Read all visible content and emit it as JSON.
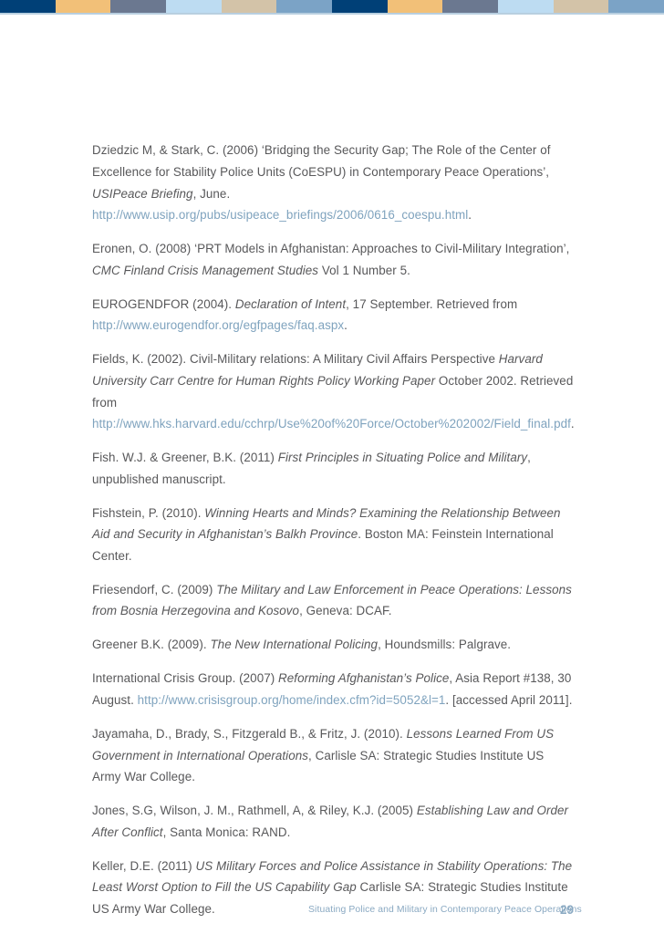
{
  "document": {
    "type": "academic-paper-bibliography",
    "page_number": "29",
    "footer_running_title": "Situating Police and Military in Contemporary Peace Operations"
  },
  "decor": {
    "top_bar_colors": [
      "#004077",
      "#f2c078",
      "#6b7890",
      "#bddcf2",
      "#d3c3a8",
      "#7ba3c6",
      "#004077",
      "#f2c078",
      "#6b7890",
      "#bddcf2",
      "#d3c3a8",
      "#7ba3c6"
    ],
    "rule_color": "#b8cfe0",
    "body_text_color": "#58585a",
    "link_color": "#7fa3be"
  },
  "references": [
    {
      "id": "dziedzic-stark-2006",
      "parts": [
        {
          "text": "Dziedzic M, & Stark, C. (2006) ‘Bridging the Security Gap; The Role of the Center of Excellence for Stability Police Units (CoESPU) in Contemporary Peace Operations’, ",
          "style": "normal"
        },
        {
          "text": "USIPeace Briefing",
          "style": "italic"
        },
        {
          "text": ", June. ",
          "style": "normal"
        },
        {
          "text": "http://www.usip.org/pubs/usipeace_briefings/2006/0616_coespu.html",
          "style": "url"
        },
        {
          "text": ".",
          "style": "normal"
        }
      ]
    },
    {
      "id": "eronen-2008",
      "parts": [
        {
          "text": "Eronen, O. (2008) ‘PRT Models in Afghanistan: Approaches to Civil-Military Integration’, ",
          "style": "normal"
        },
        {
          "text": "CMC Finland Crisis Management Studies",
          "style": "italic"
        },
        {
          "text": " Vol 1 Number 5.",
          "style": "normal"
        }
      ]
    },
    {
      "id": "eurogendfor-2004",
      "parts": [
        {
          "text": "EUROGENDFOR (2004). ",
          "style": "normal"
        },
        {
          "text": "Declaration of Intent",
          "style": "italic"
        },
        {
          "text": ", 17 September. Retrieved from ",
          "style": "normal"
        },
        {
          "text": "http://www.eurogendfor.org/egfpages/faq.aspx",
          "style": "url"
        },
        {
          "text": ".",
          "style": "normal"
        }
      ]
    },
    {
      "id": "fields-2002",
      "parts": [
        {
          "text": "Fields, K. (2002). Civil-Military relations: A Military Civil Affairs Perspective ",
          "style": "normal"
        },
        {
          "text": "Harvard University Carr Centre for Human Rights Policy Working Paper",
          "style": "italic"
        },
        {
          "text": " October 2002. Retrieved from ",
          "style": "normal"
        },
        {
          "text": "http://www.hks.harvard.edu/cchrp/Use%20of%20Force/October%202002/Field_final.pdf",
          "style": "url"
        },
        {
          "text": ".",
          "style": "normal"
        }
      ]
    },
    {
      "id": "fish-greener-2011",
      "parts": [
        {
          "text": "Fish. W.J. & Greener, B.K. (2011) ",
          "style": "normal"
        },
        {
          "text": "First Principles in Situating Police and Military",
          "style": "italic"
        },
        {
          "text": ", unpublished manuscript.",
          "style": "normal"
        }
      ]
    },
    {
      "id": "fishstein-2010",
      "parts": [
        {
          "text": "Fishstein, P. (2010). ",
          "style": "normal"
        },
        {
          "text": "Winning Hearts and Minds? Examining the Relationship Between Aid and Security in Afghanistan’s Balkh Province",
          "style": "italic"
        },
        {
          "text": ". Boston MA: Feinstein International Center.",
          "style": "normal"
        }
      ]
    },
    {
      "id": "friesendorf-2009",
      "parts": [
        {
          "text": "Friesendorf, C. (2009) ",
          "style": "normal"
        },
        {
          "text": "The Military and Law Enforcement in Peace Operations: Lessons from Bosnia Herzegovina and Kosovo",
          "style": "italic"
        },
        {
          "text": ", Geneva: DCAF.",
          "style": "normal"
        }
      ]
    },
    {
      "id": "greener-2009",
      "parts": [
        {
          "text": "Greener B.K. (2009). ",
          "style": "normal"
        },
        {
          "text": "The New International Policing",
          "style": "italic"
        },
        {
          "text": ", Houndsmills: Palgrave.",
          "style": "normal"
        }
      ]
    },
    {
      "id": "international-crisis-group-2007",
      "parts": [
        {
          "text": "International Crisis Group. (2007) ",
          "style": "normal"
        },
        {
          "text": "Reforming Afghanistan’s Police",
          "style": "italic"
        },
        {
          "text": ", Asia Report #138, 30 August. ",
          "style": "normal"
        },
        {
          "text": "http://www.crisisgroup.org/home/index.cfm?id=5052&l=1",
          "style": "url"
        },
        {
          "text": ". [accessed April 2011].",
          "style": "normal"
        }
      ]
    },
    {
      "id": "jayamaha-2010",
      "parts": [
        {
          "text": "Jayamaha, D., Brady, S., Fitzgerald B., & Fritz, J. (2010). ",
          "style": "normal"
        },
        {
          "text": "Lessons Learned From US Government in International Operations",
          "style": "italic"
        },
        {
          "text": ", Carlisle SA: Strategic Studies Institute US Army War College.",
          "style": "normal"
        }
      ]
    },
    {
      "id": "jones-2005",
      "parts": [
        {
          "text": "Jones, S.G, Wilson, J. M., Rathmell, A, & Riley, K.J. (2005) ",
          "style": "normal"
        },
        {
          "text": "Establishing Law and Order After Conflict",
          "style": "italic"
        },
        {
          "text": ", Santa Monica: RAND.",
          "style": "normal"
        }
      ]
    },
    {
      "id": "keller-2011",
      "parts": [
        {
          "text": "Keller, D.E. (2011) ",
          "style": "normal"
        },
        {
          "text": "US Military Forces and Police Assistance in Stability Operations: The Least Worst Option to Fill the US Capability Gap",
          "style": "italic"
        },
        {
          "text": " Carlisle SA: Strategic Studies Institute US Army War College.",
          "style": "normal"
        }
      ]
    }
  ]
}
